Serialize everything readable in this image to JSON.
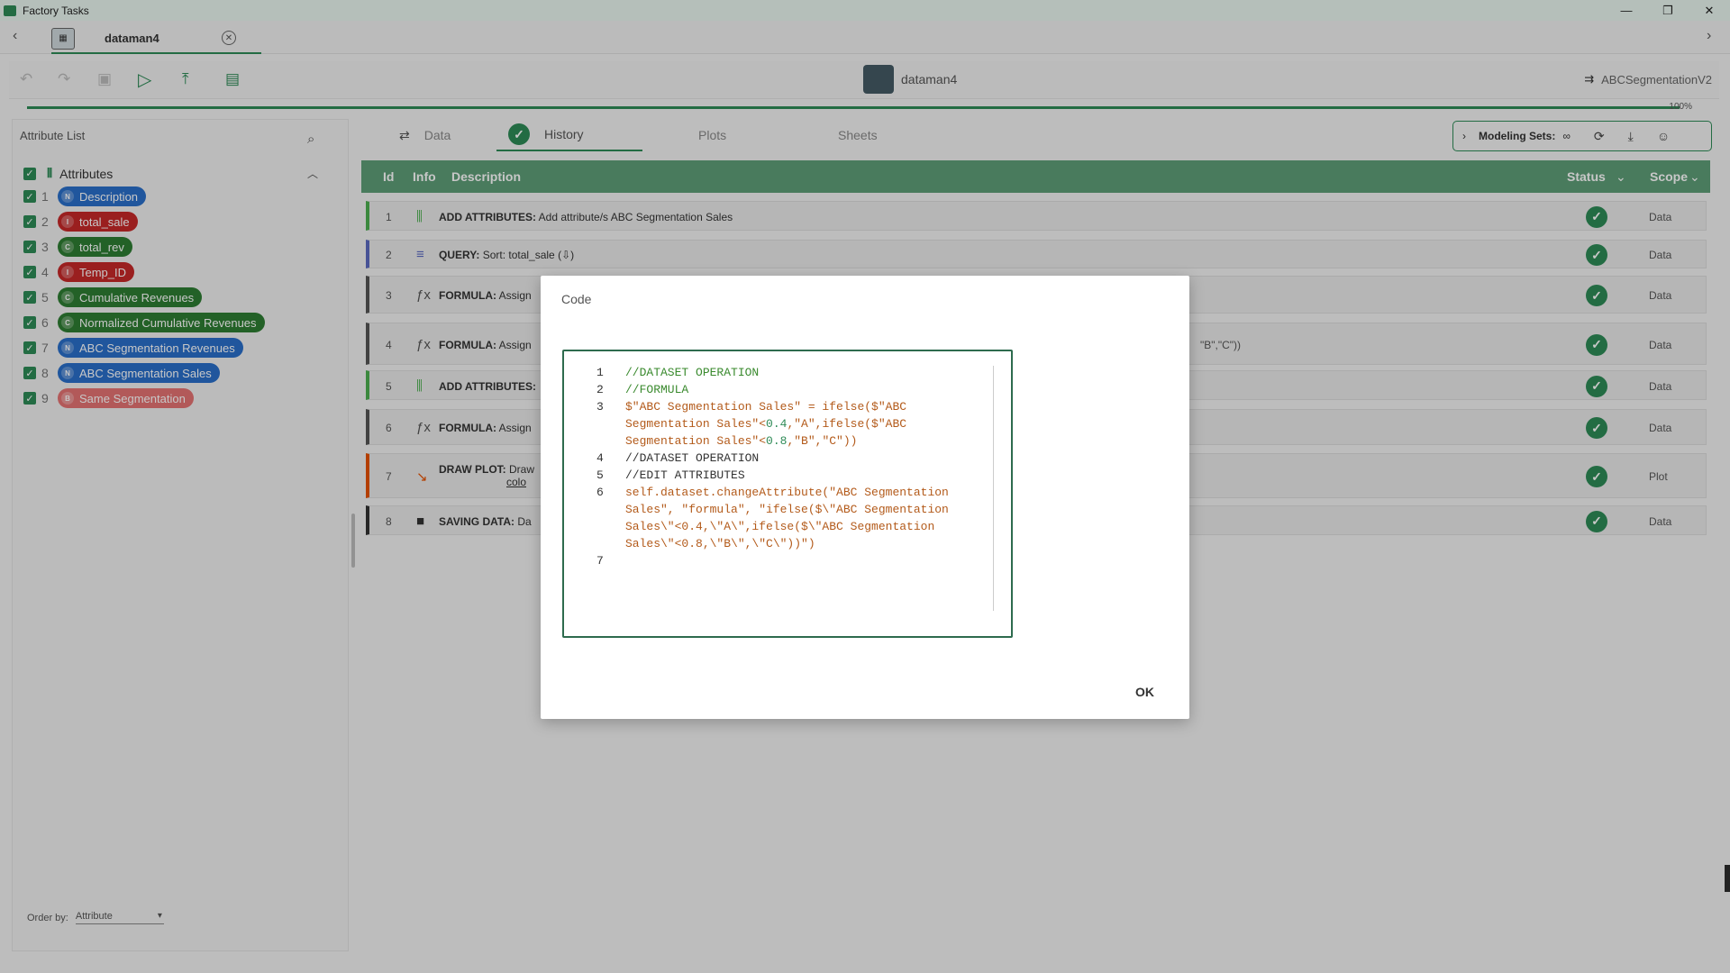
{
  "window": {
    "title": "Factory Tasks"
  },
  "tab": {
    "label": "dataman4"
  },
  "toolbar": {
    "dataset_name": "dataman4",
    "flow_name": "ABCSegmentationV2",
    "progress_label": "100%",
    "progress": 1.0
  },
  "sidebar": {
    "title": "Attribute List",
    "group_label": "Attributes",
    "order_by_label": "Order by:",
    "order_by_value": "Attribute",
    "items": [
      {
        "num": "1",
        "type": "N",
        "label": "Description",
        "color": "#2a6fc9"
      },
      {
        "num": "2",
        "type": "I",
        "label": "total_sale",
        "color": "#c62828"
      },
      {
        "num": "3",
        "type": "C",
        "label": "total_rev",
        "color": "#2e7d32"
      },
      {
        "num": "4",
        "type": "I",
        "label": "Temp_ID",
        "color": "#c62828"
      },
      {
        "num": "5",
        "type": "C",
        "label": "Cumulative Revenues",
        "color": "#2e7d32"
      },
      {
        "num": "6",
        "type": "C",
        "label": "Normalized Cumulative Revenues",
        "color": "#2e7d32"
      },
      {
        "num": "7",
        "type": "N",
        "label": "ABC Segmentation Revenues",
        "color": "#2a6fc9"
      },
      {
        "num": "8",
        "type": "N",
        "label": "ABC Segmentation Sales",
        "color": "#2a6fc9"
      },
      {
        "num": "9",
        "type": "B",
        "label": "Same Segmentation",
        "color": "#e57373"
      }
    ]
  },
  "main": {
    "tabs": [
      "Data",
      "History",
      "Plots",
      "Sheets"
    ],
    "modeling_sets_label": "Modeling Sets:",
    "columns": {
      "id": "Id",
      "info": "Info",
      "description": "Description",
      "status": "Status",
      "scope": "Scope"
    },
    "rows": [
      {
        "id": "1",
        "kind": "ADD ATTRIBUTES:",
        "text": "Add attribute/s ABC Segmentation Sales",
        "scope": "Data",
        "icon": "add-attributes-icon",
        "color": "#4caf50"
      },
      {
        "id": "2",
        "kind": "QUERY:",
        "text": "Sort: total_sale (⇩)",
        "scope": "Data",
        "icon": "filter-icon",
        "color": "#5c6bc0"
      },
      {
        "id": "3",
        "kind": "FORMULA:",
        "text": "Assign",
        "scope": "Data",
        "icon": "fx-icon",
        "color": "#555555"
      },
      {
        "id": "4",
        "kind": "FORMULA:",
        "text": "Assign",
        "scope": "Data",
        "icon": "fx-icon",
        "color": "#555555",
        "tail": "\"B\",\"C\"))"
      },
      {
        "id": "5",
        "kind": "ADD ATTRIBUTES:",
        "text": "",
        "scope": "Data",
        "icon": "add-attributes-icon",
        "color": "#4caf50"
      },
      {
        "id": "6",
        "kind": "FORMULA:",
        "text": "Assign",
        "scope": "Data",
        "icon": "fx-icon",
        "color": "#555555"
      },
      {
        "id": "7",
        "kind": "DRAW PLOT:",
        "text": "Draw",
        "text2": "colo",
        "scope": "Plot",
        "icon": "draw-plot-icon",
        "color": "#e65100"
      },
      {
        "id": "8",
        "kind": "SAVING DATA:",
        "text": "Da",
        "scope": "Data",
        "icon": "save-icon",
        "color": "#333333"
      }
    ]
  },
  "modal": {
    "title": "Code",
    "ok_label": "OK",
    "lines": [
      {
        "n": "1",
        "parts": [
          {
            "t": "//DATASET OPERATION",
            "c": "c-comment"
          }
        ]
      },
      {
        "n": "2",
        "parts": [
          {
            "t": "//FORMULA",
            "c": "c-comment"
          }
        ]
      },
      {
        "n": "3",
        "parts": [
          {
            "t": "$\"ABC Segmentation Sales\" = ifelse($\"ABC Segmentation Sales\"<",
            "c": "c-str"
          },
          {
            "t": "0.4",
            "c": "c-num"
          },
          {
            "t": ",\"A\",ifelse($\"ABC Segmentation Sales\"<",
            "c": "c-str"
          },
          {
            "t": "0.8",
            "c": "c-num"
          },
          {
            "t": ",\"B\",\"C\"))",
            "c": "c-str"
          }
        ]
      },
      {
        "n": "4",
        "parts": [
          {
            "t": "//DATASET OPERATION",
            "c": ""
          }
        ]
      },
      {
        "n": "5",
        "parts": [
          {
            "t": "//EDIT ATTRIBUTES",
            "c": ""
          }
        ]
      },
      {
        "n": "6",
        "parts": [
          {
            "t": "self.dataset.changeAttribute(\"ABC Segmentation Sales\", \"formula\", \"ifelse($\\\"ABC Segmentation Sales\\\"<0.4,\\\"A\\\",ifelse($\\\"ABC Segmentation Sales\\\"<0.8,\\\"B\\\",\\\"C\\\"))\")",
            "c": "c-str"
          }
        ]
      },
      {
        "n": "7",
        "parts": [
          {
            "t": "",
            "c": ""
          }
        ]
      }
    ]
  }
}
